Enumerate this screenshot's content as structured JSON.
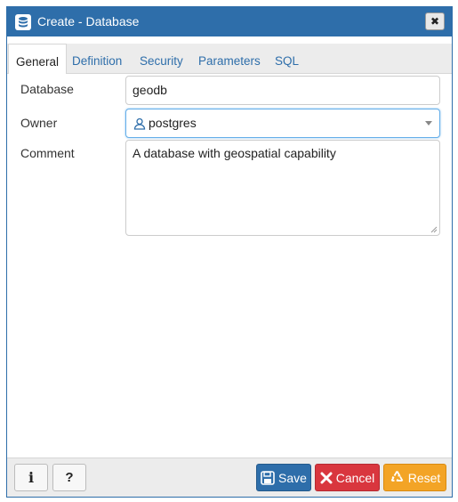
{
  "dialog": {
    "title": "Create - Database",
    "close_symbol": "✖"
  },
  "tabs": [
    {
      "label": "General",
      "active": true
    },
    {
      "label": "Definition",
      "active": false
    },
    {
      "label": "Security",
      "active": false
    },
    {
      "label": "Parameters",
      "active": false
    },
    {
      "label": "SQL",
      "active": false
    }
  ],
  "form": {
    "database_label": "Database",
    "database_value": "geodb",
    "owner_label": "Owner",
    "owner_value": "postgres",
    "comment_label": "Comment",
    "comment_value": "A database with geospatial capability"
  },
  "footer": {
    "info_label": "i",
    "help_label": "?",
    "save_label": "Save",
    "cancel_label": "Cancel",
    "reset_label": "Reset"
  },
  "colors": {
    "title_bar": "#2e6eaa",
    "save": "#2e6eaa",
    "cancel": "#d9363e",
    "reset": "#f3a426"
  },
  "icons": [
    "database-icon",
    "close-icon",
    "user-icon",
    "caret-down-icon",
    "floppy-disk-icon",
    "x-icon",
    "recycle-icon",
    "info-icon",
    "question-icon"
  ]
}
